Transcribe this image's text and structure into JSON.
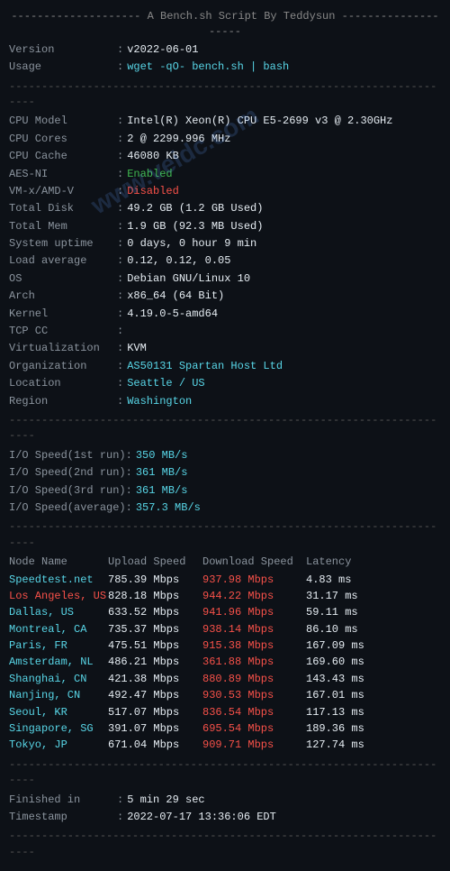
{
  "header": {
    "divider_top": "--------------------  A Bench.sh Script By Teddysun  --------------------",
    "version_label": "Version",
    "version_value": "v2022-06-01",
    "usage_label": "Usage",
    "usage_value": "wget -qO- bench.sh | bash"
  },
  "system": {
    "divider": "----------------------------------------------------------------------",
    "cpu_model_label": "CPU Model",
    "cpu_model_value": "Intel(R) Xeon(R) CPU E5-2699 v3 @ 2.30GHz",
    "cpu_cores_label": "CPU Cores",
    "cpu_cores_value": "2 @ 2299.996 MHz",
    "cpu_cache_label": "CPU Cache",
    "cpu_cache_value": "46080 KB",
    "aes_label": "AES-NI",
    "aes_value": "Enabled",
    "vm_label": "VM-x/AMD-V",
    "vm_value": "Disabled",
    "total_disk_label": "Total Disk",
    "total_disk_value": "49.2 GB (1.2 GB Used)",
    "total_mem_label": "Total Mem",
    "total_mem_value": "1.9 GB (92.3 MB Used)",
    "uptime_label": "System uptime",
    "uptime_value": "0 days, 0 hour 9 min",
    "load_label": "Load average",
    "load_value": "0.12, 0.12, 0.05",
    "os_label": "OS",
    "os_value": "Debian GNU/Linux 10",
    "arch_label": "Arch",
    "arch_value": "x86_64 (64 Bit)",
    "kernel_label": "Kernel",
    "kernel_value": "4.19.0-5-amd64",
    "tcp_label": "TCP CC",
    "tcp_value": "",
    "virt_label": "Virtualization",
    "virt_value": "KVM",
    "org_label": "Organization",
    "org_value": "AS50131 Spartan Host Ltd",
    "location_label": "Location",
    "location_value": "Seattle / US",
    "region_label": "Region",
    "region_value": "Washington"
  },
  "io": {
    "divider": "----------------------------------------------------------------------",
    "run1_label": "I/O Speed(1st run)",
    "run1_value": "350 MB/s",
    "run2_label": "I/O Speed(2nd run)",
    "run2_value": "361 MB/s",
    "run3_label": "I/O Speed(3rd run)",
    "run3_value": "361 MB/s",
    "avg_label": "I/O Speed(average)",
    "avg_value": "357.3 MB/s"
  },
  "speed_table": {
    "divider": "----------------------------------------------------------------------",
    "col_node": "Node Name",
    "col_upload": "Upload Speed",
    "col_download": "Download Speed",
    "col_latency": "Latency",
    "rows": [
      {
        "node": "Speedtest.net",
        "upload": "785.39 Mbps",
        "download": "937.98 Mbps",
        "latency": "4.83 ms",
        "node_color": "cyan",
        "dl_color": "red"
      },
      {
        "node": "Los Angeles, US",
        "upload": "828.18 Mbps",
        "download": "944.22 Mbps",
        "latency": "31.17 ms",
        "node_color": "red",
        "dl_color": "red"
      },
      {
        "node": "Dallas, US",
        "upload": "633.52 Mbps",
        "download": "941.96 Mbps",
        "latency": "59.11 ms",
        "node_color": "cyan",
        "dl_color": "red"
      },
      {
        "node": "Montreal, CA",
        "upload": "735.37 Mbps",
        "download": "938.14 Mbps",
        "latency": "86.10 ms",
        "node_color": "cyan",
        "dl_color": "red"
      },
      {
        "node": "Paris, FR",
        "upload": "475.51 Mbps",
        "download": "915.38 Mbps",
        "latency": "167.09 ms",
        "node_color": "cyan",
        "dl_color": "red"
      },
      {
        "node": "Amsterdam, NL",
        "upload": "486.21 Mbps",
        "download": "361.88 Mbps",
        "latency": "169.60 ms",
        "node_color": "cyan",
        "dl_color": "red"
      },
      {
        "node": "Shanghai, CN",
        "upload": "421.38 Mbps",
        "download": "880.89 Mbps",
        "latency": "143.43 ms",
        "node_color": "cyan",
        "dl_color": "red"
      },
      {
        "node": "Nanjing, CN",
        "upload": "492.47 Mbps",
        "download": "930.53 Mbps",
        "latency": "167.01 ms",
        "node_color": "cyan",
        "dl_color": "red"
      },
      {
        "node": "Seoul, KR",
        "upload": "517.07 Mbps",
        "download": "836.54 Mbps",
        "latency": "117.13 ms",
        "node_color": "cyan",
        "dl_color": "red"
      },
      {
        "node": "Singapore, SG",
        "upload": "391.07 Mbps",
        "download": "695.54 Mbps",
        "latency": "189.36 ms",
        "node_color": "cyan",
        "dl_color": "red"
      },
      {
        "node": "Tokyo, JP",
        "upload": "671.04 Mbps",
        "download": "909.71 Mbps",
        "latency": "127.74 ms",
        "node_color": "cyan",
        "dl_color": "red"
      }
    ]
  },
  "footer": {
    "divider": "----------------------------------------------------------------------",
    "finished_label": "Finished in",
    "finished_value": "5 min 29 sec",
    "timestamp_label": "Timestamp",
    "timestamp_value": "2022-07-17 13:36:06 EDT",
    "divider_bottom": "----------------------------------------------------------------------"
  },
  "watermark": {
    "line1": "www.veidc.com"
  }
}
